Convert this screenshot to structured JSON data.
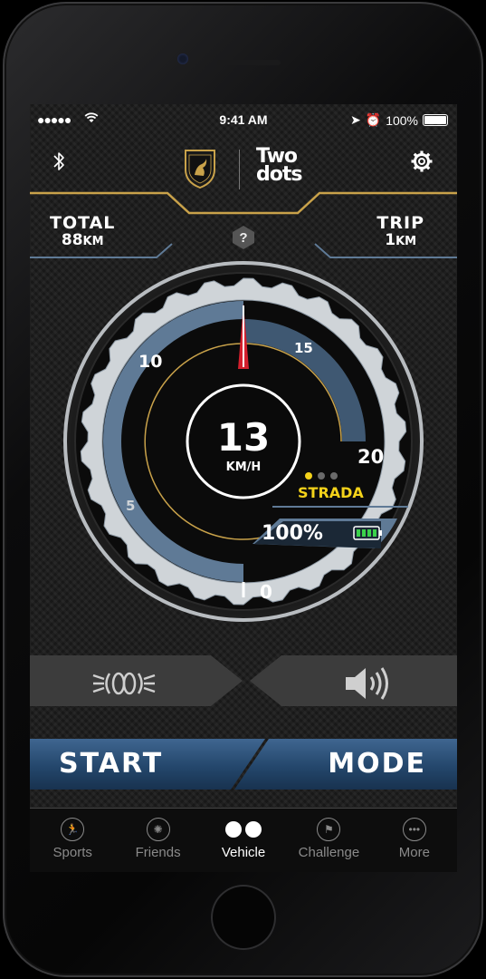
{
  "status_bar": {
    "signal": "●●●●●",
    "time": "9:41 AM",
    "battery": "100%"
  },
  "header": {
    "brand_line1": "Two",
    "brand_line2": "dots",
    "crest_text": "AUTOMOBILI LAMBORGHINI"
  },
  "odometer": {
    "total_label": "TOTAL",
    "total_value": "88",
    "total_unit": "KM",
    "trip_label": "TRIP",
    "trip_value": "1",
    "trip_unit": "KM",
    "help": "?"
  },
  "gauge": {
    "speed": "13",
    "unit": "KM/H",
    "ticks": [
      "0",
      "5",
      "10",
      "15",
      "20"
    ],
    "mode_label": "STRADA",
    "battery_percent": "100%",
    "colors": {
      "accent_gold": "#c9a24a",
      "mode_yellow": "#f3d21a",
      "needle": "#d41f2d",
      "battery_green": "#3bd24b",
      "ring_blue": "#5f7a96"
    }
  },
  "controls": {
    "lights_icon": "headlights-icon",
    "sound_icon": "speaker-icon"
  },
  "actions": {
    "start_label": "START",
    "mode_label": "MODE"
  },
  "tabs": [
    {
      "label": "Sports",
      "icon": "sports-icon"
    },
    {
      "label": "Friends",
      "icon": "friends-icon"
    },
    {
      "label": "Vehicle",
      "icon": "vehicle-icon"
    },
    {
      "label": "Challenge",
      "icon": "flag-icon"
    },
    {
      "label": "More",
      "icon": "more-icon"
    }
  ],
  "active_tab": "Vehicle"
}
